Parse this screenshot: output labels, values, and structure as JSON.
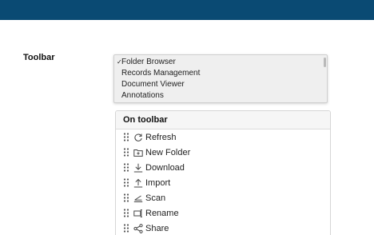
{
  "section": {
    "label": "Toolbar"
  },
  "dropdown": {
    "options": [
      {
        "label": "Folder Browser",
        "checked": true
      },
      {
        "label": "Records Management",
        "checked": false
      },
      {
        "label": "Document Viewer",
        "checked": false
      },
      {
        "label": "Annotations",
        "checked": false
      }
    ],
    "check_glyph": "✓"
  },
  "panel": {
    "title": "On toolbar",
    "items": [
      {
        "label": "Refresh",
        "icon": "refresh-icon"
      },
      {
        "label": "New Folder",
        "icon": "new-folder-icon"
      },
      {
        "label": "Download",
        "icon": "download-icon"
      },
      {
        "label": "Import",
        "icon": "import-icon"
      },
      {
        "label": "Scan",
        "icon": "scan-icon"
      },
      {
        "label": "Rename",
        "icon": "rename-icon"
      },
      {
        "label": "Share",
        "icon": "share-icon"
      }
    ]
  },
  "colors": {
    "topbar": "#0a4a73",
    "accent_underline": "#e0533b"
  }
}
